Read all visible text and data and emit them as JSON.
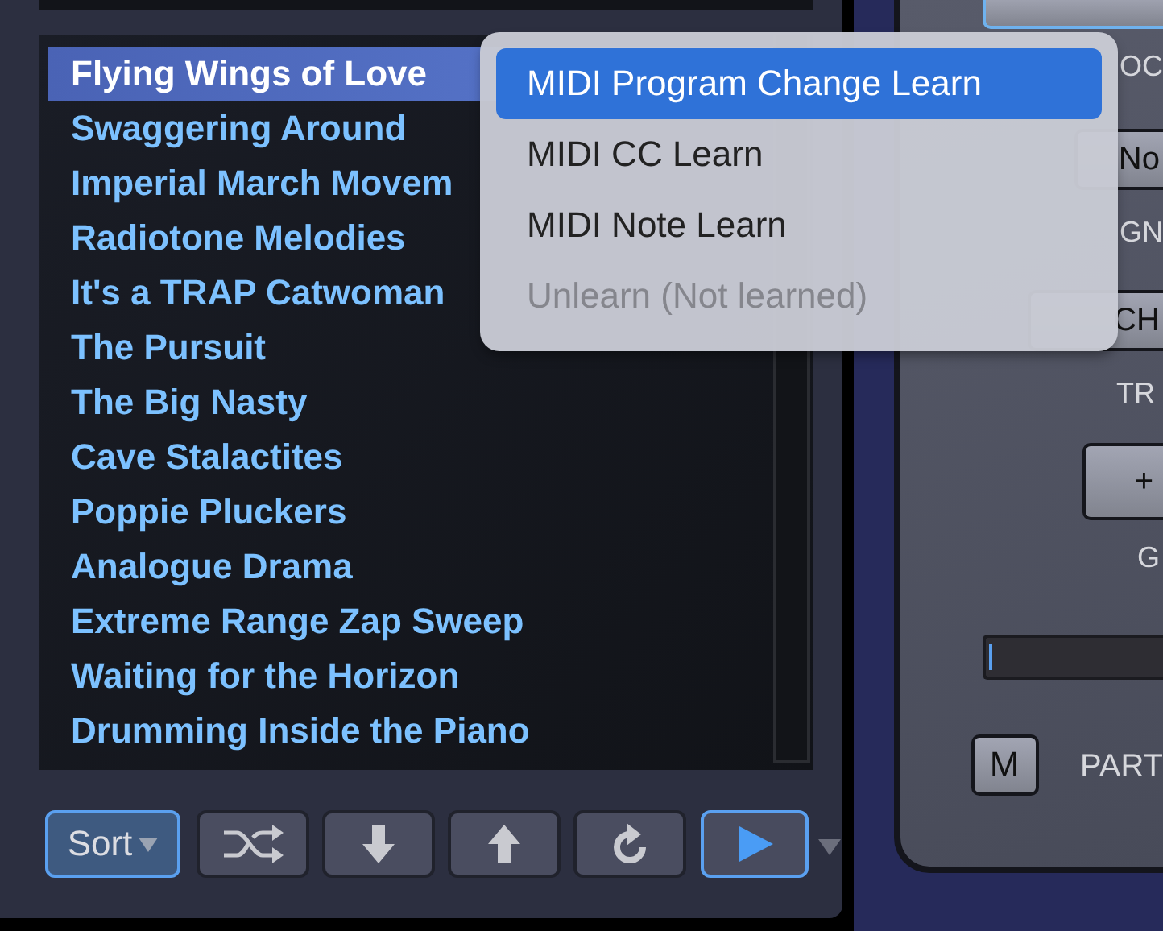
{
  "songs": [
    {
      "title": "Flying Wings of Love",
      "selected": true
    },
    {
      "title": "Swaggering Around",
      "selected": false
    },
    {
      "title": "Imperial March Movem",
      "selected": false
    },
    {
      "title": "Radiotone Melodies",
      "selected": false
    },
    {
      "title": "It's a TRAP Catwoman",
      "selected": false
    },
    {
      "title": "The Pursuit",
      "selected": false
    },
    {
      "title": "The Big Nasty",
      "selected": false
    },
    {
      "title": "Cave Stalactites",
      "selected": false
    },
    {
      "title": "Poppie Pluckers",
      "selected": false
    },
    {
      "title": "Analogue Drama",
      "selected": false
    },
    {
      "title": "Extreme Range Zap Sweep",
      "selected": false
    },
    {
      "title": "Waiting for the Horizon",
      "selected": false
    },
    {
      "title": "Drumming Inside the Piano",
      "selected": false
    }
  ],
  "toolbar": [
    {
      "kind": "sort",
      "label": "Sort",
      "active": true
    },
    {
      "kind": "shuffle",
      "active": false
    },
    {
      "kind": "down",
      "active": false
    },
    {
      "kind": "up",
      "active": false
    },
    {
      "kind": "reload",
      "active": false
    },
    {
      "kind": "play",
      "active": true
    }
  ],
  "context_menu": [
    {
      "label": "MIDI Program Change Learn",
      "selected": true,
      "disabled": false
    },
    {
      "label": "MIDI CC Learn",
      "selected": false,
      "disabled": false
    },
    {
      "label": "MIDI Note Learn",
      "selected": false,
      "disabled": false
    },
    {
      "label": "Unlearn (Not learned)",
      "selected": false,
      "disabled": true
    }
  ],
  "part_panel": [
    {
      "kind": "button"
    },
    {
      "kind": "label",
      "text": "OC"
    },
    {
      "kind": "button",
      "text": "No"
    },
    {
      "kind": "label",
      "text": "GN"
    },
    {
      "kind": "button",
      "text": "CH"
    },
    {
      "kind": "label",
      "text": "TR"
    },
    {
      "kind": "button",
      "text": "+"
    },
    {
      "kind": "label",
      "text": "G"
    },
    {
      "kind": "slider",
      "level": 0
    },
    {
      "kind": "button",
      "text": "M"
    },
    {
      "kind": "label",
      "text": "PART"
    }
  ]
}
